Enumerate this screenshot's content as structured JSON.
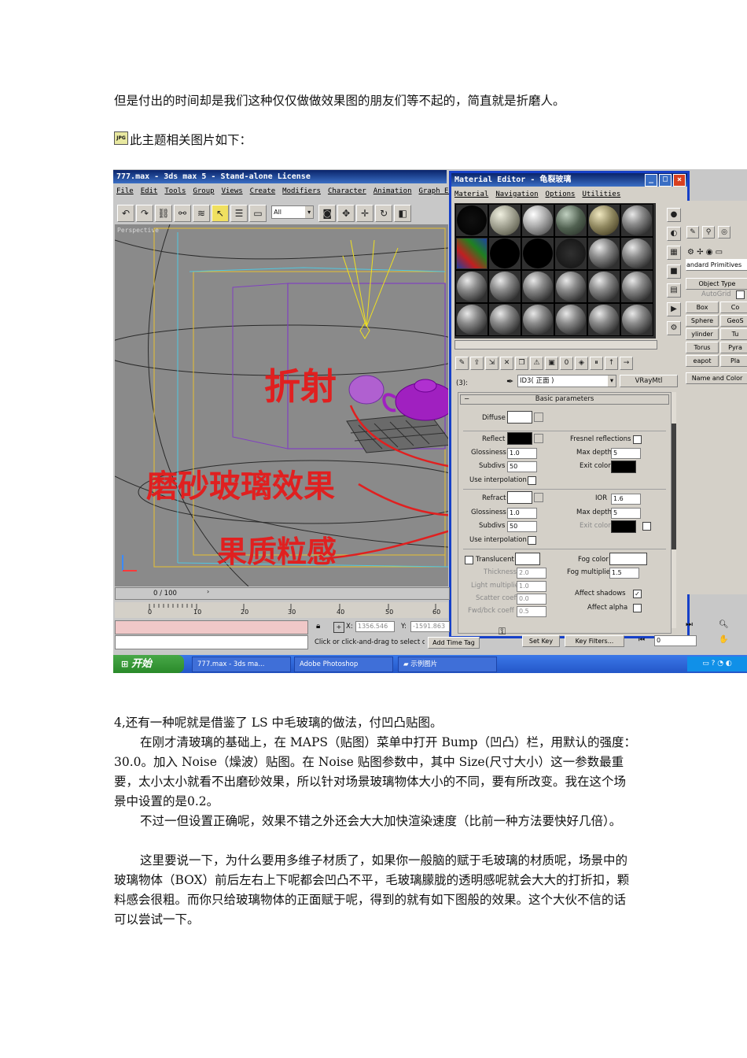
{
  "para1": "但是付出的时间却是我们这种仅仅做做效果图的朋友们等不起的，简直就是折磨人。",
  "jpg_badge": "JPG",
  "related_caption": "此主题相关图片如下：",
  "screenshot": {
    "max_title": "777.max - 3ds max 5 - Stand-alone License",
    "menu": [
      "File",
      "Edit",
      "Tools",
      "Group",
      "Views",
      "Create",
      "Modifiers",
      "Character",
      "Animation",
      "Graph Edit"
    ],
    "selection_filter": "All",
    "viewport_label": "Perspective",
    "annotations": {
      "refraction": "折射",
      "frosted": "磨砂玻璃效果",
      "result": "果质粒感"
    },
    "mat_title": "Material Editor - 龟裂玻璃",
    "mat_menu": [
      "Material",
      "Navigation",
      "Options",
      "Utilities"
    ],
    "slot_number": "(3):",
    "mat_name": "ID3( 正面 )",
    "mat_type": "VRayMtl",
    "rollout": "Basic parameters",
    "diffuse": "Diffuse",
    "reflect": "Reflect",
    "fresnel": "Fresnel reflections",
    "gloss_label": "Glossiness",
    "gloss_val": "1.0",
    "maxdepth_label": "Max depth",
    "maxdepth_val": "5",
    "subdivs_label": "Subdivs",
    "subdivs_val": "50",
    "exit_color": "Exit color",
    "use_interp": "Use interpolation",
    "refract": "Refract",
    "ior_label": "IOR",
    "ior_val": "1.6",
    "translucent": "Translucent",
    "fog_color": "Fog color",
    "thickness": "Thickness",
    "thickness_val": "2.0",
    "fog_mult": "Fog multiplier",
    "fog_mult_val": "1.5",
    "light_mult": "Light multiplier",
    "light_mult_val": "1.0",
    "scatter": "Scatter coeff",
    "scatter_val": "0.0",
    "fwd": "Fwd/bck coeff",
    "fwd_val": "0.5",
    "affect_shadows": "Affect shadows",
    "affect_alpha": "Affect alpha",
    "cmd_dropdown": "andard Primitives",
    "object_type": "Object Type",
    "autogrid": "AutoGrid",
    "prims": [
      "Box",
      "Co",
      "Sphere",
      "GeoS",
      "ylinder",
      "Tu",
      "Torus",
      "Pyra",
      "eapot",
      "Pla"
    ],
    "name_color": "Name and Color",
    "frame": "0 / 100",
    "ruler": [
      "0",
      "10",
      "20",
      "30",
      "40",
      "50",
      "60"
    ],
    "x_coord": "1356.546",
    "y_coord": "-1591.863",
    "status_hint": "Click or click-and-drag to select obj",
    "add_time_tag": "Add Time Tag",
    "set_key": "Set Key",
    "key_filters": "Key Filters...",
    "frame_field": "0",
    "start": "开始",
    "tasks": [
      "777.max - 3ds ma...",
      "Adobe Photoshop",
      "示例图片"
    ]
  },
  "para2": "4,还有一种呢就是借鉴了 LS 中毛玻璃的做法，付凹凸贴图。",
  "para3": "在刚才清玻璃的基础上，在 MAPS（贴图）菜单中打开 Bump（凹凸）栏，用默认的强度：30.0。加入 Noise（燥波）贴图。在 Noise 贴图参数中，其中 Size(尺寸大小）这一参数最重要，太小太小就看不出磨砂效果，所以针对场景玻璃物体大小的不同，要有所改变。我在这个场景中设置的是0.2。",
  "para4": "不过一但设置正确呢，效果不错之外还会大大加快渲染速度（比前一种方法要快好几倍）。",
  "para5": "这里要说一下，为什么要用多维子材质了，如果你一般脑的赋于毛玻璃的材质呢，场景中的玻璃物体（BOX）前后左右上下呢都会凹凸不平，毛玻璃朦胧的透明感呢就会大大的打折扣，颗料感会很粗。而你只给玻璃物体的正面赋于呢，得到的就有如下图般的效果。这个大伙不信的话可以尝试一下。"
}
